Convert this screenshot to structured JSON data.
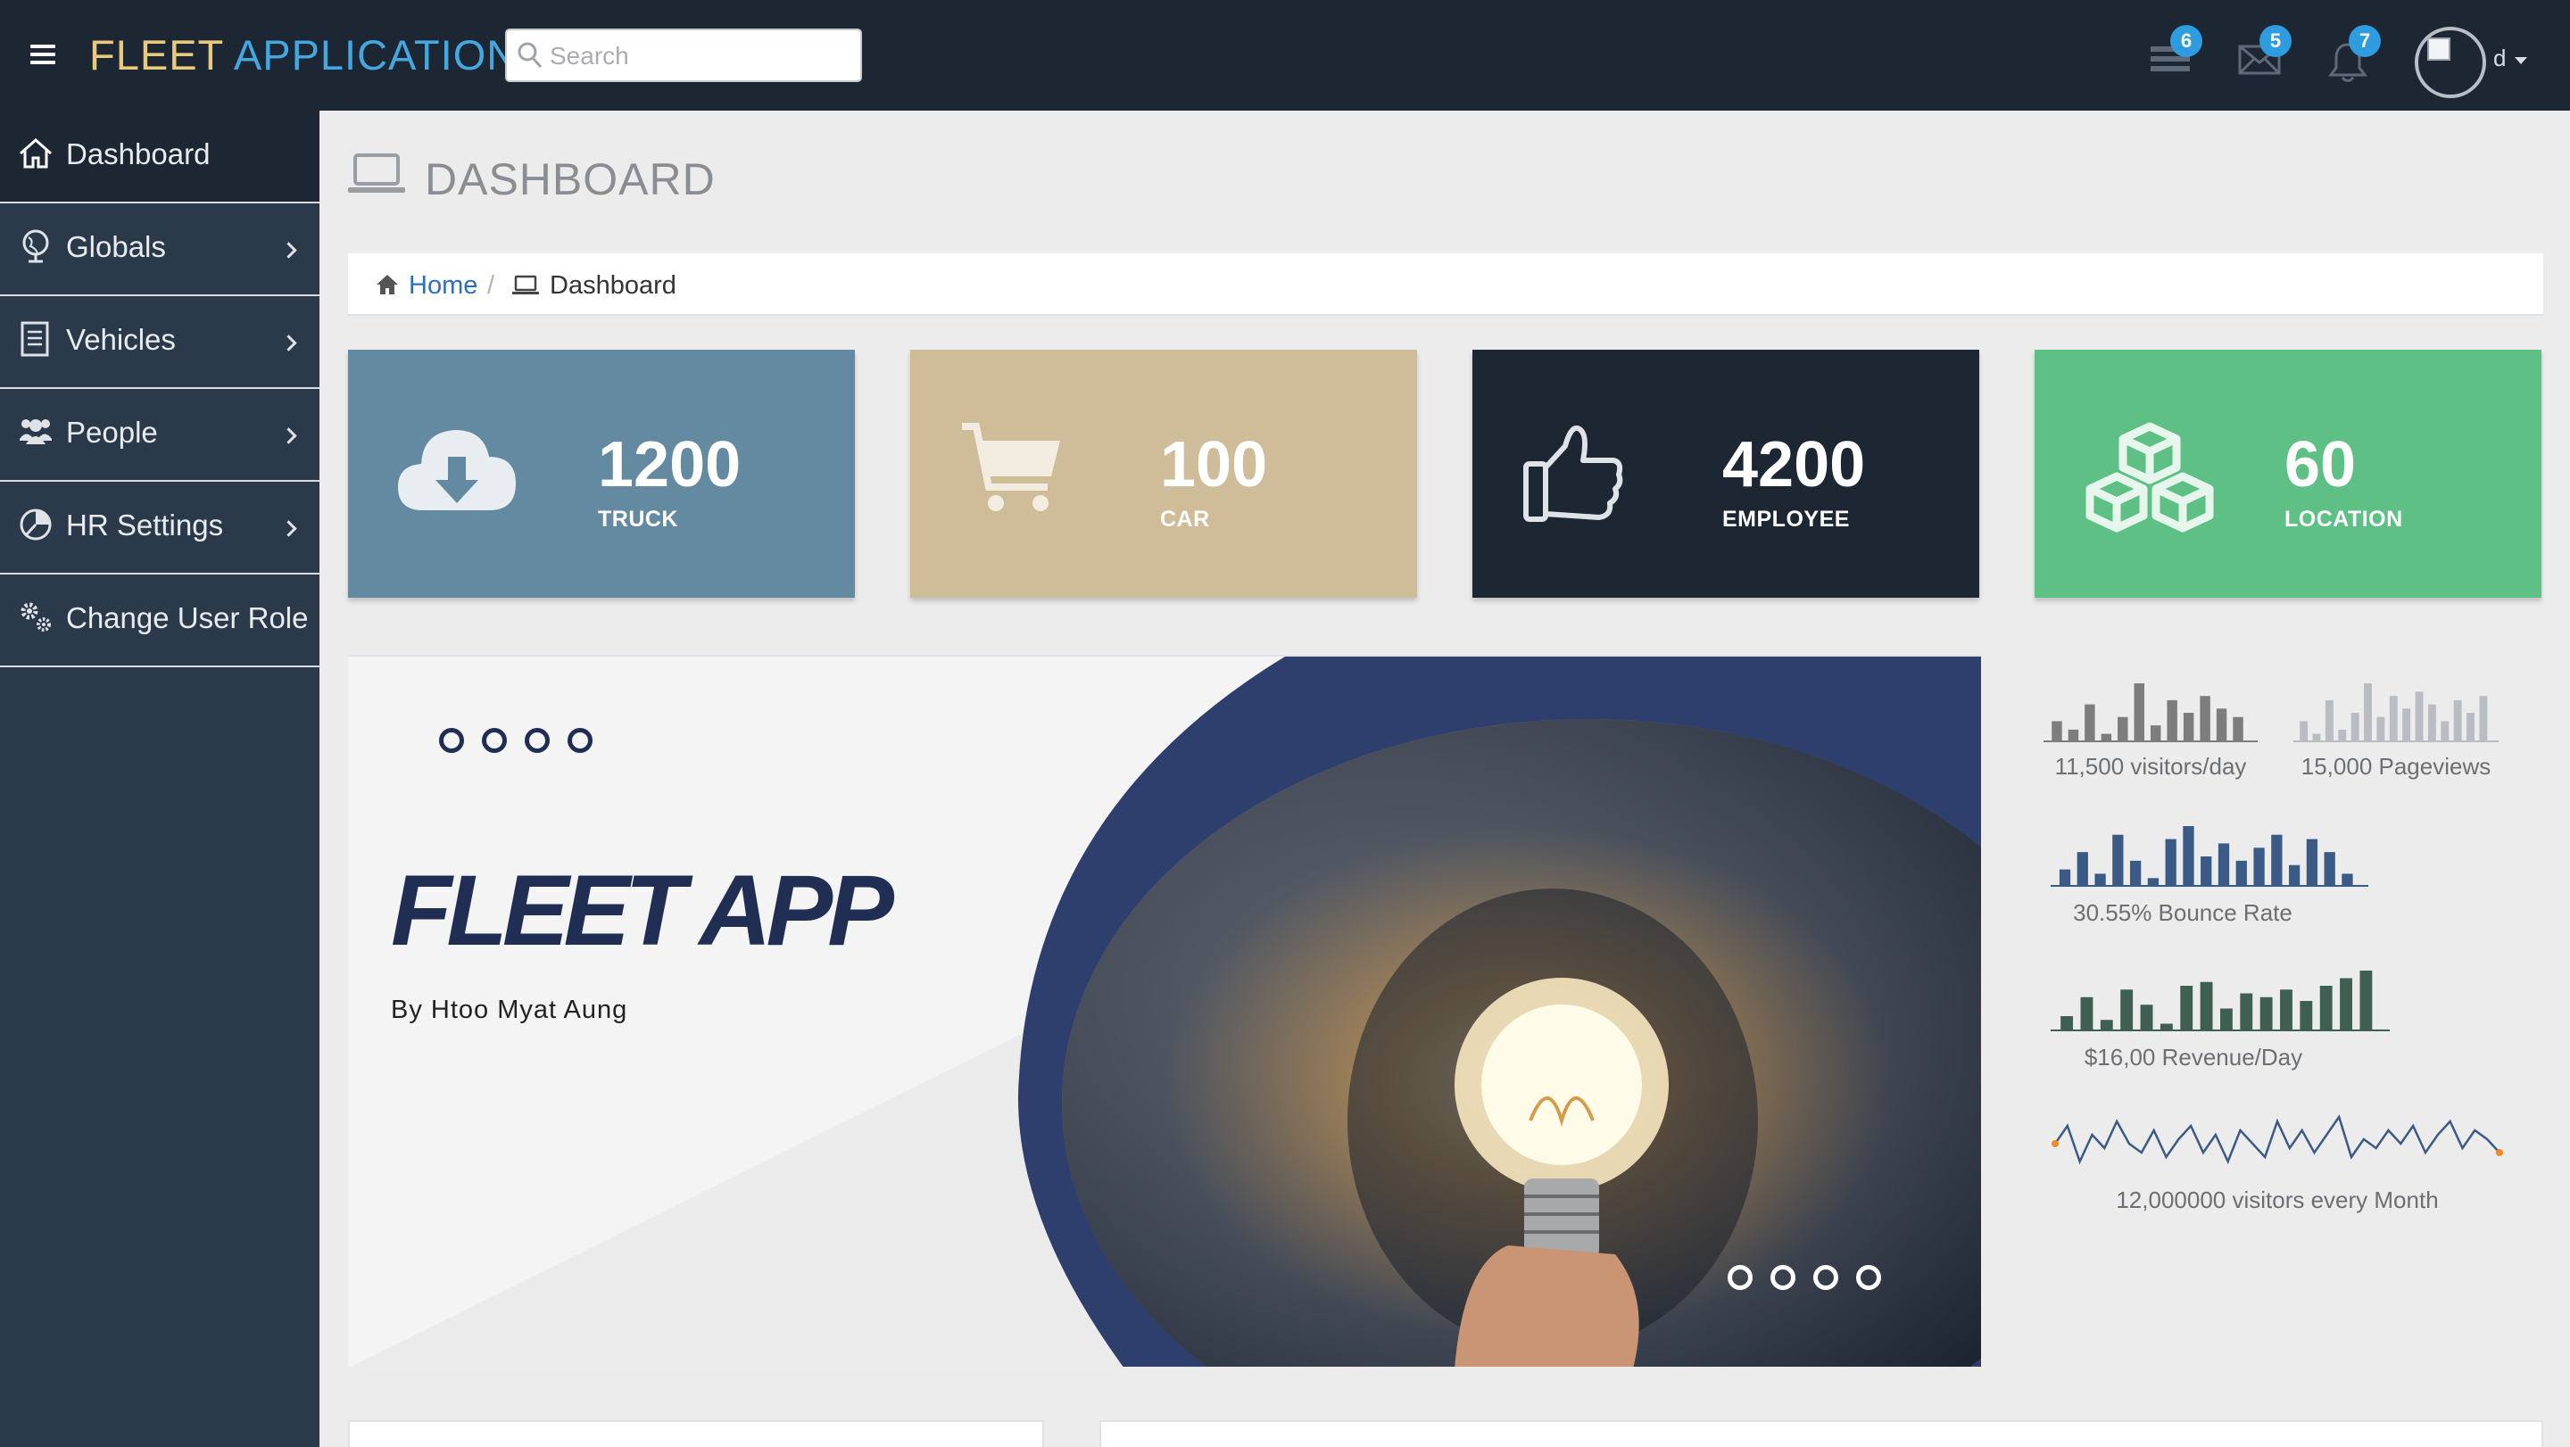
{
  "header": {
    "brand_part1": "FLEET",
    "brand_part2": "APPLICATION",
    "search_placeholder": "Search",
    "notifications": [
      {
        "icon": "tasks-icon",
        "count": "6"
      },
      {
        "icon": "envelope-icon",
        "count": "5"
      },
      {
        "icon": "bell-icon",
        "count": "7"
      }
    ],
    "user_name": "d"
  },
  "sidebar": {
    "items": [
      {
        "label": "Dashboard",
        "icon": "home-icon",
        "active": true
      },
      {
        "label": "Globals",
        "icon": "globe-icon"
      },
      {
        "label": "Vehicles",
        "icon": "document-icon"
      },
      {
        "label": "People",
        "icon": "users-icon"
      },
      {
        "label": "HR Settings",
        "icon": "pie-chart-icon"
      },
      {
        "label": "Change User Role",
        "icon": "gears-icon"
      }
    ]
  },
  "page": {
    "title": "DASHBOARD",
    "breadcrumb": {
      "home": "Home",
      "separator": "/",
      "current": "Dashboard"
    }
  },
  "cards": [
    {
      "value": "1200",
      "label": "TRUCK",
      "icon": "cloud-download-icon",
      "color": "#638aa0"
    },
    {
      "value": "100",
      "label": "CAR",
      "icon": "shopping-cart-icon",
      "color": "#cfbc98"
    },
    {
      "value": "4200",
      "label": "EMPLOYEE",
      "icon": "thumbs-up-icon",
      "color": "#1d2734"
    },
    {
      "value": "60",
      "label": "LOCATION",
      "icon": "cubes-icon",
      "color": "#5ec085"
    }
  ],
  "banner": {
    "title": "FLEET APP",
    "subtitle": "By Htoo Myat Aung",
    "accent_color": "#2e3f6e"
  },
  "stats": [
    {
      "label": "11,500 visitors/day",
      "color": "#7d7d7d",
      "bars": [
        5,
        3,
        9,
        2,
        6,
        14,
        4,
        10,
        7,
        11,
        8,
        6
      ]
    },
    {
      "label": "15,000 Pageviews",
      "color": "#b9bdc2",
      "bars": [
        5,
        2,
        10,
        3,
        7,
        14,
        6,
        11,
        8,
        12,
        9,
        5,
        10,
        7,
        11
      ]
    },
    {
      "label": "30.55% Bounce Rate",
      "color": "#3c5a86",
      "bars": [
        4,
        8,
        3,
        12,
        6,
        2,
        11,
        14,
        7,
        10,
        6,
        9,
        12,
        5,
        11,
        8,
        3
      ]
    },
    {
      "label": "$16,00 Revenue/Day",
      "color": "#3f5f52",
      "bars": [
        4,
        9,
        3,
        11,
        7,
        2,
        12,
        13,
        6,
        10,
        9,
        11,
        8,
        12,
        14,
        16
      ]
    },
    {
      "label": "12,000000 visitors every Month",
      "color": "#3c5a86",
      "line": [
        6,
        10,
        2,
        8,
        5,
        11,
        6,
        4,
        9,
        3,
        7,
        10,
        4,
        8,
        2,
        9,
        6,
        3,
        11,
        5,
        9,
        4,
        8,
        12,
        3,
        7,
        5,
        9,
        6,
        10,
        4,
        8,
        11,
        5,
        9,
        7,
        4
      ]
    }
  ]
}
